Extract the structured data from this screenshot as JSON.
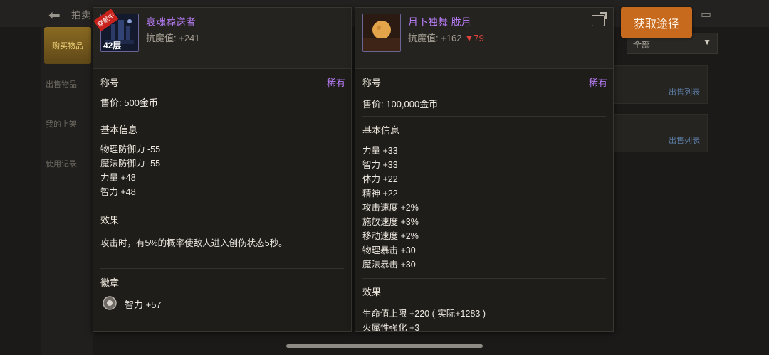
{
  "background": {
    "title": "拍卖",
    "sidebar": [
      "购买物品",
      "出售物品",
      "我的上架",
      "使用记录"
    ],
    "filter_value": "全部",
    "card_link": "出售列表"
  },
  "get_button": "获取途径",
  "left_item": {
    "name": "哀魂葬送者",
    "icon_tag": "穿戴中",
    "level_badge": "42层",
    "resist": "抗魔值: +241",
    "type_label": "称号",
    "rarity": "稀有",
    "price": "售价: 500金币",
    "basic_title": "基本信息",
    "stats": [
      "物理防御力 -55",
      "魔法防御力 -55",
      "力量 +48",
      "智力 +48"
    ],
    "effect_title": "效果",
    "effect_text": "攻击时，有5%的概率使敌人进入创伤状态5秒。",
    "badge_title": "徽章",
    "badge_stat": "智力 +57"
  },
  "right_item": {
    "name": "月下独舞-胧月",
    "resist": "抗魔值: +162",
    "resist_diff": "▼79",
    "type_label": "称号",
    "rarity": "稀有",
    "price": "售价: 100,000金币",
    "basic_title": "基本信息",
    "stats": [
      "力量 +33",
      "智力 +33",
      "体力 +22",
      "精神 +22",
      "攻击速度 +2%",
      "施放速度 +3%",
      "移动速度 +2%",
      "物理暴击 +30",
      "魔法暴击 +30"
    ],
    "effect_title": "效果",
    "effect_lines": [
      "生命值上限 +220 ( 实际+1283 )",
      "火属性强化 +3"
    ]
  },
  "colors": {
    "rarity": "#b77cf6",
    "button": "#c86a1e",
    "down": "#e0443c"
  }
}
